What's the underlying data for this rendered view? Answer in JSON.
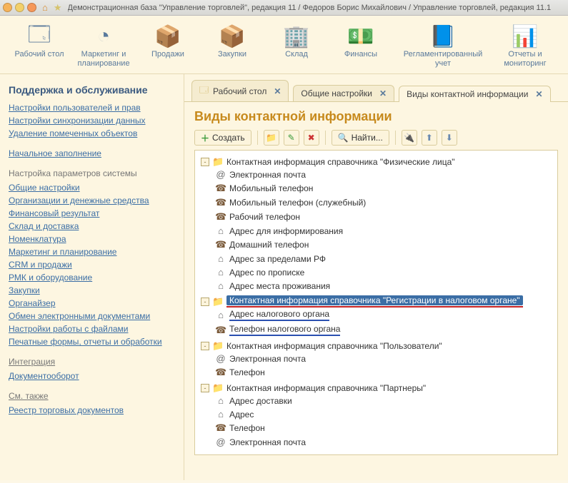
{
  "window": {
    "title": "Демонстрационная база \"Управление торговлей\", редакция 11 / Федоров Борис Михайлович / Управление торговлей, редакция 11.1"
  },
  "toolbar": [
    {
      "id": "desktop",
      "label": "Рабочий стол",
      "emoji": "🗔"
    },
    {
      "id": "marketing",
      "label": "Маркетинг и планирование",
      "emoji": "◔"
    },
    {
      "id": "sales",
      "label": "Продажи",
      "emoji": "📦"
    },
    {
      "id": "purchases",
      "label": "Закупки",
      "emoji": "📦"
    },
    {
      "id": "warehouse",
      "label": "Склад",
      "emoji": "🏢"
    },
    {
      "id": "finance",
      "label": "Финансы",
      "emoji": "💵"
    },
    {
      "id": "regaccount",
      "label": "Регламентированный учет",
      "emoji": "📘",
      "wide": true
    },
    {
      "id": "reports",
      "label": "Отчеты и мониторинг",
      "emoji": "📊"
    }
  ],
  "sidebar": {
    "heading": "Поддержка и обслуживание",
    "topLinks": [
      "Настройки пользователей и прав",
      "Настройки синхронизации данных",
      "Удаление помеченных объектов"
    ],
    "fill": "Начальное заполнение",
    "sysHeading": "Настройка параметров системы",
    "sysLinks": [
      "Общие настройки",
      "Организации и денежные средства",
      "Финансовый результат",
      "Склад и доставка",
      "Номенклатура",
      "Маркетинг и планирование",
      "CRM и продажи",
      "РМК и оборудование",
      "Закупки",
      "Органайзер",
      "Обмен электронными документами",
      "Настройки работы с файлами",
      "Печатные формы, отчеты и обработки"
    ],
    "intHeading": "Интеграция",
    "intLinks": [
      "Документооборот"
    ],
    "seeHeading": "См. также",
    "seeLinks": [
      "Реестр торговых документов"
    ]
  },
  "tabs": [
    {
      "id": "desktop",
      "label": "Рабочий стол",
      "active": false,
      "icon": "🗔"
    },
    {
      "id": "general",
      "label": "Общие настройки",
      "active": false,
      "icon": ""
    },
    {
      "id": "contacts",
      "label": "Виды контактной информации",
      "active": true,
      "icon": ""
    }
  ],
  "page": {
    "title": "Виды контактной информации",
    "actions": {
      "create": "Создать",
      "find": "Найти..."
    }
  },
  "tree": [
    {
      "type": "folder",
      "toggle": "-",
      "label": "Контактная информация справочника \"Физические лица\"",
      "children": [
        {
          "type": "mail",
          "label": "Электронная почта"
        },
        {
          "type": "phone",
          "label": "Мобильный телефон"
        },
        {
          "type": "phone",
          "label": "Мобильный телефон (служебный)"
        },
        {
          "type": "phone",
          "label": "Рабочий телефон"
        },
        {
          "type": "home",
          "label": "Адрес для информирования"
        },
        {
          "type": "phone",
          "label": "Домашний телефон"
        },
        {
          "type": "home",
          "label": "Адрес за пределами РФ"
        },
        {
          "type": "home",
          "label": "Адрес по прописке"
        },
        {
          "type": "home",
          "label": "Адрес места проживания"
        }
      ]
    },
    {
      "type": "folder",
      "toggle": "-",
      "highlight": true,
      "label": "Контактная информация справочника \"Регистрации в налоговом органе\"",
      "children": [
        {
          "type": "home",
          "label": "Адрес налогового органа",
          "blue": true
        },
        {
          "type": "phone",
          "label": "Телефон налогового органа",
          "blue": true
        }
      ]
    },
    {
      "type": "folder",
      "toggle": "-",
      "label": "Контактная информация справочника \"Пользователи\"",
      "children": [
        {
          "type": "mail",
          "label": "Электронная почта"
        },
        {
          "type": "phone",
          "label": "Телефон"
        }
      ]
    },
    {
      "type": "folder",
      "toggle": "-",
      "label": "Контактная информация справочника \"Партнеры\"",
      "children": [
        {
          "type": "home",
          "label": "Адрес доставки"
        },
        {
          "type": "home",
          "label": "Адрес"
        },
        {
          "type": "phone",
          "label": "Телефон"
        },
        {
          "type": "mail",
          "label": "Электронная почта"
        }
      ]
    }
  ]
}
